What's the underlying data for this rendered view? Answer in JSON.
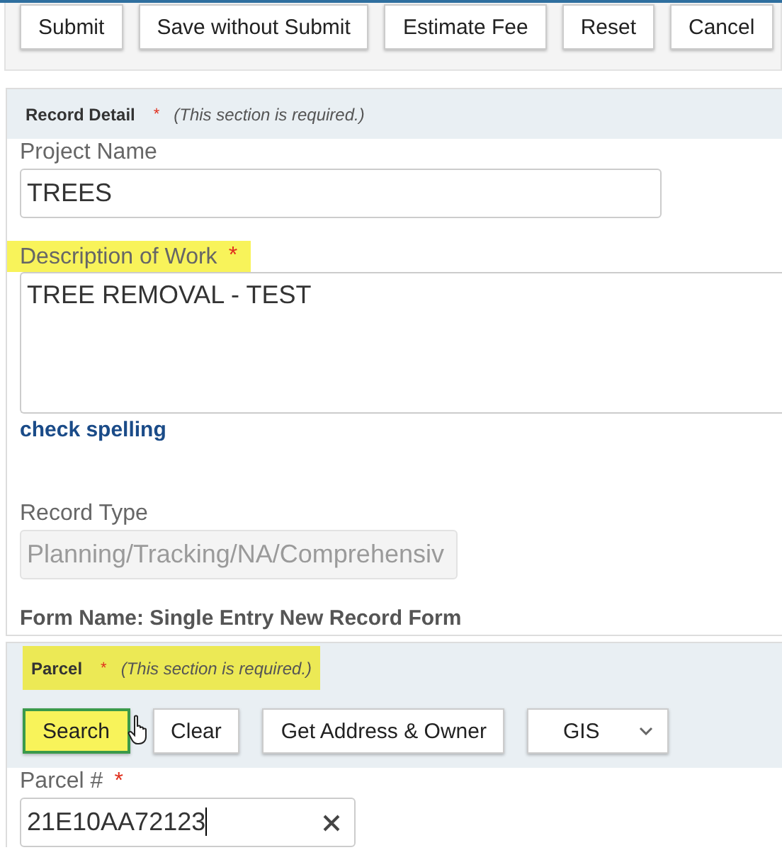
{
  "toolbar": {
    "buttons": [
      {
        "label": "Submit"
      },
      {
        "label": "Save without Submit"
      },
      {
        "label": "Estimate Fee"
      },
      {
        "label": "Reset"
      },
      {
        "label": "Cancel"
      }
    ]
  },
  "record_detail": {
    "header": {
      "title": "Record Detail",
      "required_mark": "*",
      "note": "(This section is required.)",
      "highlighted": false
    },
    "items": [
      {
        "kind": "text",
        "label": "Project Name",
        "value": "TREES",
        "highlighted": false,
        "disabled": false
      },
      {
        "kind": "textarea",
        "label": "Description of Work",
        "required_mark": "*",
        "value": "TREE REMOVAL - TEST",
        "highlighted": true,
        "disabled": false
      },
      {
        "kind": "link",
        "text": "check spelling"
      },
      {
        "kind": "text",
        "label": "Record Type",
        "value": "Planning/Tracking/NA/Comprehensiv",
        "highlighted": false,
        "disabled": true
      },
      {
        "kind": "note",
        "text": "Form Name: Single Entry New Record Form"
      }
    ]
  },
  "parcel": {
    "header": {
      "title": "Parcel",
      "required_mark": "*",
      "note": "(This section is required.)",
      "highlighted": true
    },
    "buttons": [
      {
        "kind": "button",
        "label": "Search",
        "highlighted": true
      },
      {
        "kind": "button",
        "label": "Clear",
        "highlighted": false
      },
      {
        "kind": "button",
        "label": "Get Address & Owner",
        "highlighted": false
      },
      {
        "kind": "dropdown",
        "label": "GIS",
        "highlighted": false
      }
    ],
    "field": {
      "label": "Parcel #",
      "required_mark": "*",
      "value": "21E10AA72123",
      "focused": true
    }
  }
}
